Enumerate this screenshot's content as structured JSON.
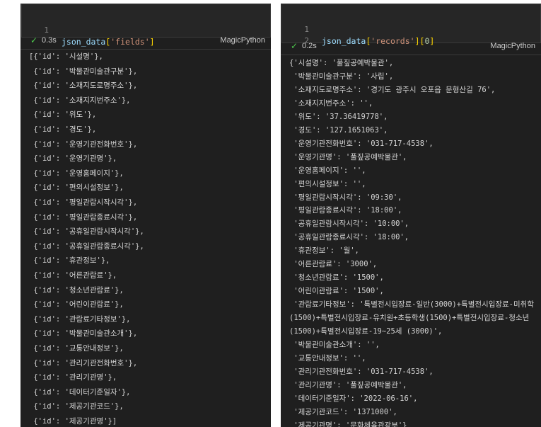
{
  "left": {
    "cell": {
      "line_number": "1",
      "code_var": "json_data",
      "code_open": "[",
      "code_str": "'fields'",
      "code_close": "]",
      "time": "0.3s",
      "language": "MagicPython"
    },
    "output_lines": [
      "[{'id': '시설명'},",
      " {'id': '박물관미술관구분'},",
      " {'id': '소재지도로명주소'},",
      " {'id': '소재지지번주소'},",
      " {'id': '위도'},",
      " {'id': '경도'},",
      " {'id': '운영기관전화번호'},",
      " {'id': '운영기관명'},",
      " {'id': '운영홈페이지'},",
      " {'id': '편의시설정보'},",
      " {'id': '평일관람시작시각'},",
      " {'id': '평일관람종료시각'},",
      " {'id': '공휴일관람시작시각'},",
      " {'id': '공휴일관람종료시각'},",
      " {'id': '휴관정보'},",
      " {'id': '어른관람료'},",
      " {'id': '청소년관람료'},",
      " {'id': '어린이관람료'},",
      " {'id': '관람료기타정보'},",
      " {'id': '박물관미술관소개'},",
      " {'id': '교통안내정보'},",
      " {'id': '관리기관전화번호'},",
      " {'id': '관리기관명'},",
      " {'id': '데이터기준일자'},",
      " {'id': '제공기관코드'},",
      " {'id': '제공기관명'}]"
    ]
  },
  "right": {
    "cell": {
      "line_number_1": "1",
      "line_number_2": "2",
      "code_var": "json_data",
      "code_open": "[",
      "code_str": "'records'",
      "code_close": "]",
      "code_idx_open": "[",
      "code_idx": "0",
      "code_idx_close": "]",
      "time": "0.2s",
      "language": "MagicPython"
    },
    "output_lines": [
      "{'시설명': '풀짚공예박물관',",
      " '박물관미술관구분': '사립',",
      " '소재지도로명주소': '경기도 광주시 오포읍 문형산길 76',",
      " '소재지지번주소': '',",
      " '위도': '37.36419778',",
      " '경도': '127.1651063',",
      " '운영기관전화번호': '031-717-4538',",
      " '운영기관명': '풀짚공예박물관',",
      " '운영홈페이지': '',",
      " '편의시설정보': '',",
      " '평일관람시작시각': '09:30',",
      " '평일관람종료시각': '18:00',",
      " '공휴일관람시작시각': '10:00',",
      " '공휴일관람종료시각': '18:00',",
      " '휴관정보': '월',",
      " '어른관람료': '3000',",
      " '청소년관람료': '1500',",
      " '어린이관람료': '1500',",
      " '관람료기타정보': '특별전시입장료-일반(3000)+특별전시입장료-미취학",
      "(1500)+특별전시입장료-유치원+초등학생(1500)+특별전시입장료-청소년",
      "(1500)+특별전시입장료-19~25세 (3000)',",
      " '박물관미술관소개': '',",
      " '교통안내정보': '',",
      " '관리기관전화번호': '031-717-4538',",
      " '관리기관명': '풀짚공예박물관',",
      " '데이터기준일자': '2022-06-16',",
      " '제공기관코드': '1371000',",
      " '제공기관명': '문화체육관광부'}"
    ]
  }
}
